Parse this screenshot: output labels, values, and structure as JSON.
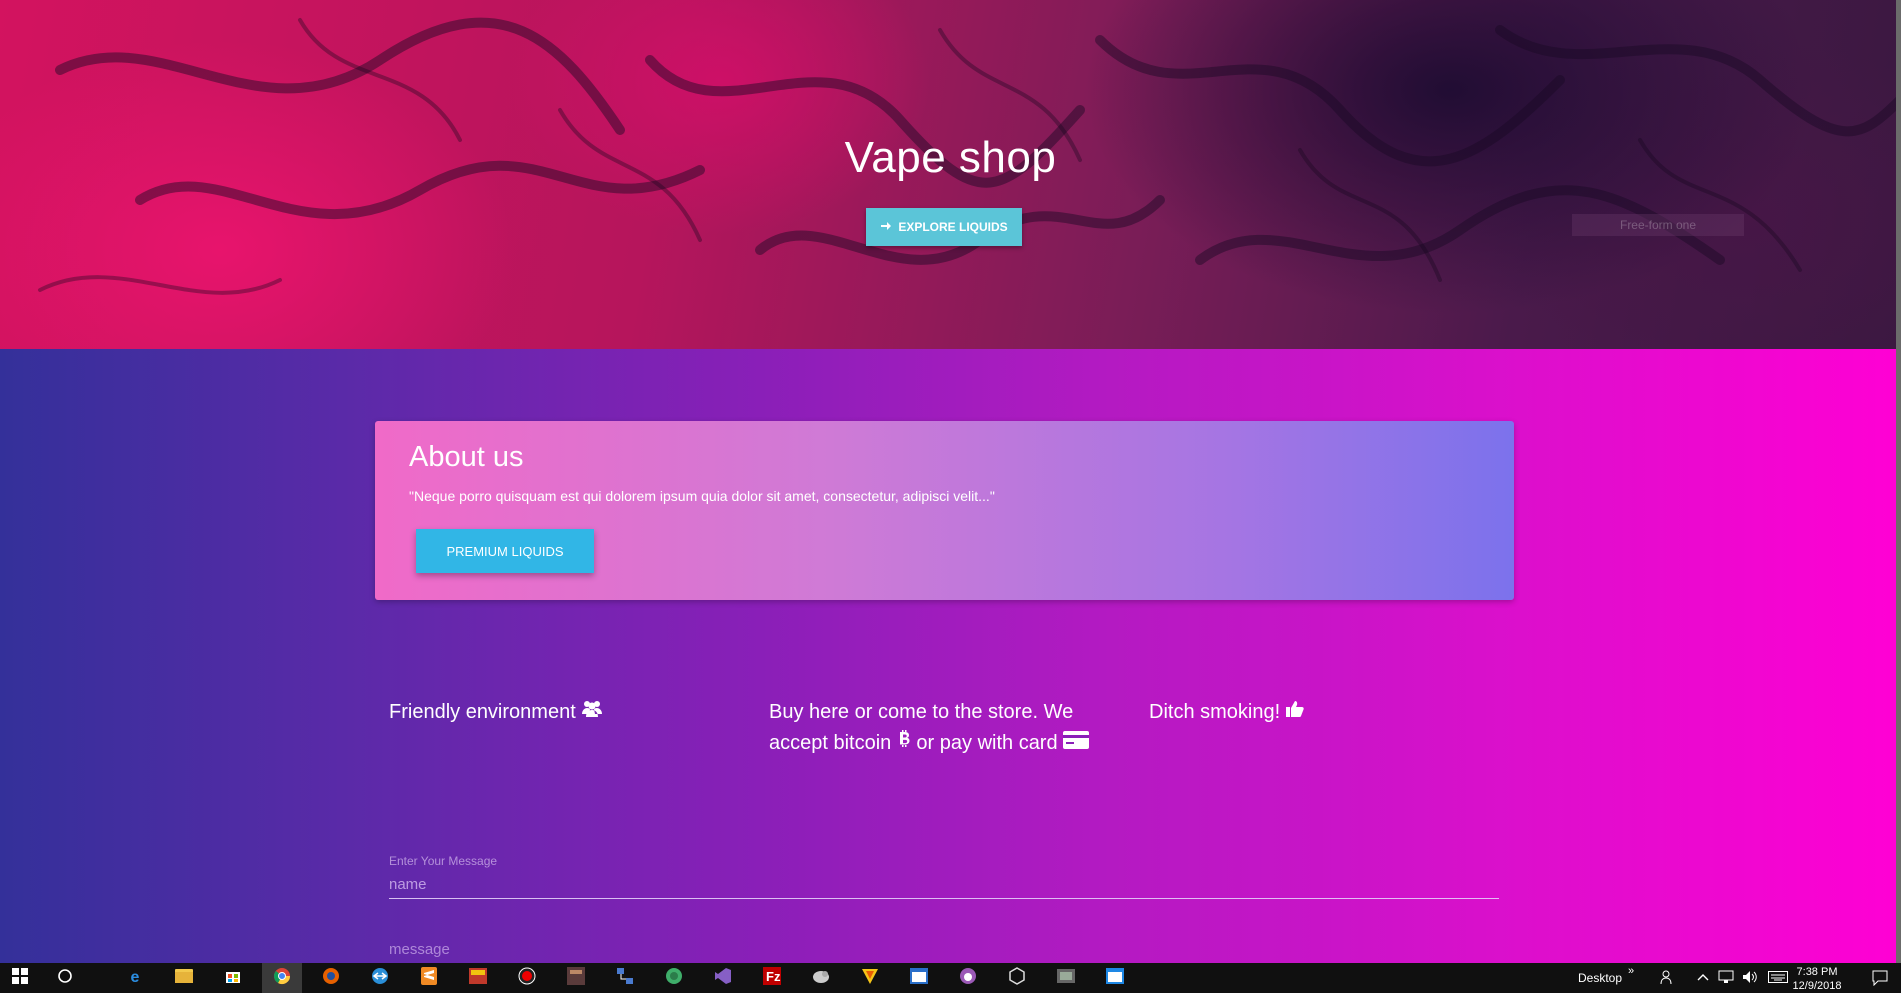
{
  "hero": {
    "title": "Vape shop",
    "explore_button": "EXPLORE LIQUIDS",
    "ghost_chip": "Free-form one"
  },
  "about": {
    "title": "About us",
    "text": "\"Neque porro quisquam est qui dolorem ipsum quia dolor sit amet, consectetur, adipisci velit...\"",
    "button": "PREMIUM LIQUIDS"
  },
  "features": [
    {
      "text": "Friendly environment",
      "icon": "users-icon"
    },
    {
      "text_a": "Buy here or come to the store. We accept bitcoin",
      "text_b": "or pay with card",
      "icons": [
        "bitcoin-icon",
        "credit-card-icon"
      ]
    },
    {
      "text": "Ditch smoking!",
      "icon": "thumbs-up-icon"
    }
  ],
  "form": {
    "label": "Enter Your Message",
    "name_placeholder": "name",
    "message_placeholder": "message"
  },
  "taskbar": {
    "desktop_label": "Desktop",
    "time": "7:38 PM",
    "date": "12/9/2018"
  },
  "colors": {
    "hero_pink": "#d3135f",
    "explore_button": "#5bc5d8",
    "premium_button": "#31b6e6",
    "gradient_left": "#34309a",
    "gradient_right": "#ff00d4"
  }
}
